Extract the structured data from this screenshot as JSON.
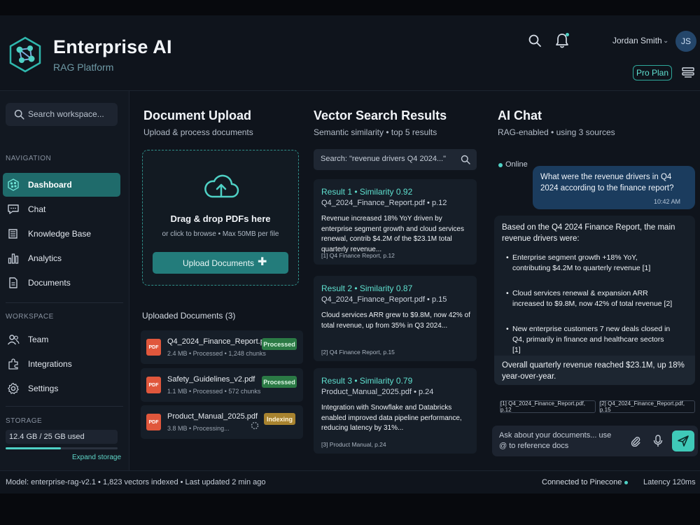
{
  "brand": {
    "title": "Enterprise AI",
    "subtitle": "RAG Platform"
  },
  "header": {
    "user_name": "Jordan Smith",
    "avatar_initials": "JS",
    "plan": "Pro Plan",
    "accent": "#4fd1c5"
  },
  "sidebar": {
    "search_placeholder": "Search workspace...",
    "nav_section": "NAVIGATION",
    "nav": [
      {
        "label": "Dashboard",
        "icon": "dashboard-icon",
        "active": true
      },
      {
        "label": "Chat",
        "icon": "chat-icon"
      },
      {
        "label": "Knowledge Base",
        "icon": "knowledge-base-icon"
      },
      {
        "label": "Analytics",
        "icon": "analytics-icon"
      },
      {
        "label": "Documents",
        "icon": "documents-icon"
      }
    ],
    "workspace_section": "WORKSPACE",
    "workspace": [
      {
        "label": "Team",
        "icon": "team-icon"
      },
      {
        "label": "Integrations",
        "icon": "integrations-icon"
      },
      {
        "label": "Settings",
        "icon": "settings-icon"
      }
    ],
    "storage_section": "STORAGE",
    "storage_used": "12.4 GB / 25 GB used",
    "storage_fraction": 0.496,
    "expand_storage": "Expand storage"
  },
  "upload": {
    "title": "Document Upload",
    "subtitle": "Upload & process documents",
    "drop_title": "Drag & drop PDFs here",
    "drop_sub": "or click to browse • Max 50MB per file",
    "button": "Upload Documents",
    "uploaded_title": "Uploaded Documents (3)",
    "pdf_label": "PDF",
    "docs": [
      {
        "name": "Q4_2024_Finance_Report.pdf",
        "meta": "2.4 MB • Processed • 1,248 chunks",
        "status": "Processed"
      },
      {
        "name": "Safety_Guidelines_v2.pdf",
        "meta": "1.1 MB • Processed • 572 chunks",
        "status": "Processed"
      },
      {
        "name": "Product_Manual_2025.pdf",
        "meta": "3.8 MB • Processing...",
        "status": "Indexing"
      }
    ]
  },
  "vector": {
    "title": "Vector Search Results",
    "subtitle": "Semantic similarity • top 5 results",
    "query": "Search: \"revenue drivers Q4 2024...\"",
    "results": [
      {
        "title": "Result 1 • Similarity 0.92",
        "file": "Q4_2024_Finance_Report.pdf • p.12",
        "text": "Revenue increased 18% YoY driven by enterprise segment growth and cloud services renewal, contrib $4.2M of the $23.1M total quarterly revenue...",
        "cite": "[1] Q4 Finance Report, p.12"
      },
      {
        "title": "Result 2 • Similarity 0.87",
        "file": "Q4_2024_Finance_Report.pdf • p.15",
        "text": "Cloud services ARR grew to $9.8M, now 42% of total revenue, up from 35% in Q3 2024...",
        "cite": "[2] Q4 Finance Report, p.15"
      },
      {
        "title": "Result 3 • Similarity 0.79",
        "file": "Product_Manual_2025.pdf • p.24",
        "text": "Integration with Snowflake and Databricks enabled improved data pipeline performance, reducing latency by 31%...",
        "cite": "[3] Product Manual, p.24"
      }
    ]
  },
  "chat": {
    "title": "AI Chat",
    "subtitle": "RAG-enabled • using 3 sources",
    "status": "Online",
    "user_message": "What were the revenue drivers in Q4 2024 according to the finance report?",
    "user_time": "10:42 AM",
    "ai_intro": "Based on the Q4 2024 Finance Report, the main revenue drivers were:",
    "ai_bullets": [
      {
        "text": "Enterprise segment growth +18% YoY, contributing $4.2M to quarterly revenue [1]"
      },
      {
        "text": "Cloud services renewal & expansion ARR increased to $9.8M, now 42% of total revenue [2]"
      },
      {
        "text": "New enterprise customers 7 new deals closed in Q4, primarily in finance and healthcare sectors [1]"
      }
    ],
    "ai_summary": "Overall quarterly revenue reached $23.1M, up 18% year-over-year.",
    "sources": [
      "[1] Q4_2024_Finance_Report.pdf, p.12",
      "[2] Q4_2024_Finance_Report.pdf, p.15"
    ],
    "input_placeholder": "Ask about your documents... use @ to reference docs"
  },
  "status_bar": {
    "left": "Model: enterprise-rag-v2.1  •  1,823 vectors indexed  •  Last updated 2 min ago",
    "connection": "Connected to Pinecone",
    "latency": "Latency 120ms"
  }
}
